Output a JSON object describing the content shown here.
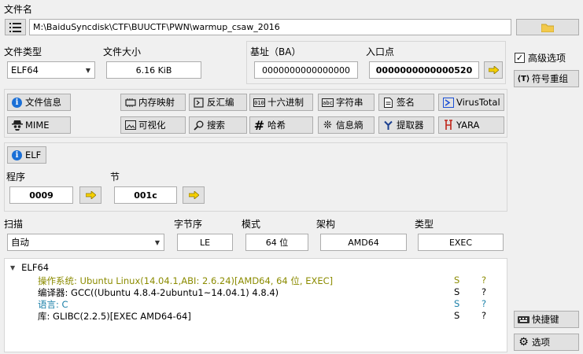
{
  "file_name": {
    "label": "文件名",
    "path": "M:\\BaiduSyncdisk\\CTF\\BUUCTF\\PWN\\warmup_csaw_2016"
  },
  "file_type": {
    "label": "文件类型",
    "value": "ELF64"
  },
  "file_size": {
    "label": "文件大小",
    "value": "6.16 KiB"
  },
  "base_address": {
    "label": "基址（BA）",
    "value": "0000000000000000"
  },
  "entry_point": {
    "label": "入口点",
    "value": "0000000000000520"
  },
  "side": {
    "advanced_checked": true,
    "advanced_label": "高级选项",
    "symbol_label": "符号重组",
    "shortcuts_label": "快捷键",
    "options_label": "选项"
  },
  "toolbar": {
    "row1": [
      "文件信息",
      "内存映射",
      "反汇编",
      "十六进制",
      "字符串",
      "签名",
      "VirusTotal"
    ],
    "row2": [
      "MIME",
      "可视化",
      "搜索",
      "哈希",
      "信息熵",
      "提取器",
      "YARA"
    ]
  },
  "elf": {
    "button_label": "ELF",
    "program_label": "程序",
    "program_value": "0009",
    "section_label": "节",
    "section_value": "001c"
  },
  "scan": {
    "scan_label": "扫描",
    "scan_value": "自动",
    "endian_label": "字节序",
    "endian_value": "LE",
    "mode_label": "模式",
    "mode_value": "64 位",
    "arch_label": "架构",
    "arch_value": "AMD64",
    "type_label": "类型",
    "type_value": "EXEC"
  },
  "results": {
    "root": "ELF64",
    "rows": [
      {
        "text": "操作系统: Ubuntu Linux(14.04.1,ABI: 2.6.24)[AMD64, 64 位, EXEC]",
        "s": "S",
        "q": "?",
        "color": "#8b8b00"
      },
      {
        "text": "编译器: GCC((Ubuntu 4.8.4-2ubuntu1~14.04.1) 4.8.4)",
        "s": "S",
        "q": "?",
        "color": "#000000"
      },
      {
        "text": "语言: C",
        "s": "S",
        "q": "?",
        "color": "#1a7fa8"
      },
      {
        "text": "库: GLIBC(2.2.5)[EXEC AMD64-64]",
        "s": "S",
        "q": "?",
        "color": "#000000"
      }
    ]
  }
}
